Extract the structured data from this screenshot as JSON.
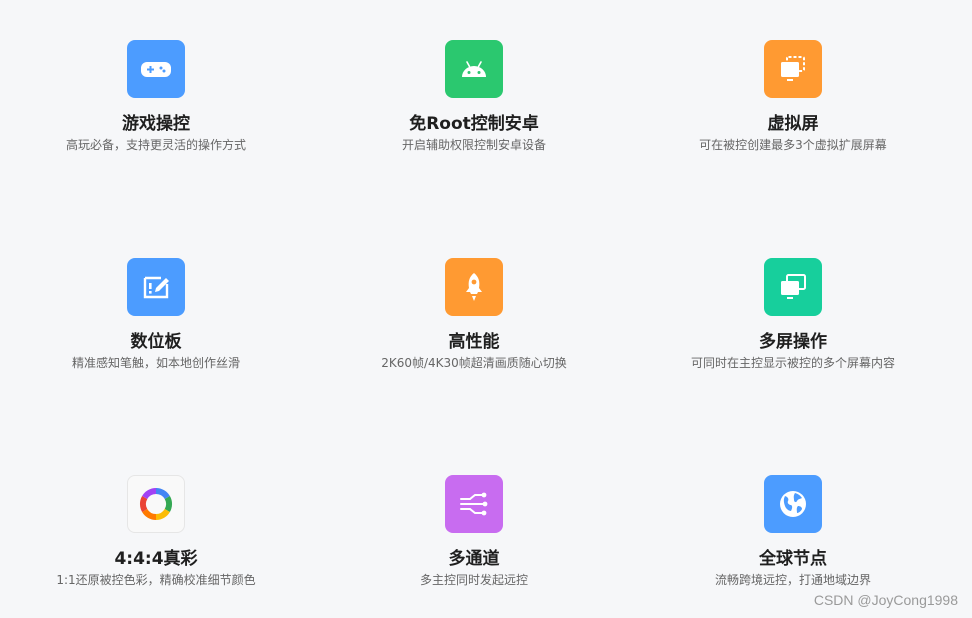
{
  "features": [
    {
      "title": "游戏操控",
      "desc": "高玩必备，支持更灵活的操作方式",
      "icon": "gamepad-icon",
      "color": "#4c9cff"
    },
    {
      "title": "免Root控制安卓",
      "desc": "开启辅助权限控制安卓设备",
      "icon": "android-icon",
      "color": "#2bc86f"
    },
    {
      "title": "虚拟屏",
      "desc": "可在被控创建最多3个虚拟扩展屏幕",
      "icon": "virtual-screen-icon",
      "color": "#ff9a32"
    },
    {
      "title": "数位板",
      "desc": "精准感知笔触，如本地创作丝滑",
      "icon": "tablet-pen-icon",
      "color": "#4c9cff"
    },
    {
      "title": "高性能",
      "desc": "2K60帧/4K30帧超清画质随心切换",
      "icon": "rocket-icon",
      "color": "#ff9a32"
    },
    {
      "title": "多屏操作",
      "desc": "可同时在主控显示被控的多个屏幕内容",
      "icon": "multi-screen-icon",
      "color": "#17cf9c"
    },
    {
      "title": "4:4:4真彩",
      "desc": "1:1还原被控色彩，精确校准细节颜色",
      "icon": "color-wheel-icon",
      "color": "#f9f9f9"
    },
    {
      "title": "多通道",
      "desc": "多主控同时发起远控",
      "icon": "multi-channel-icon",
      "color": "#c86cf0"
    },
    {
      "title": "全球节点",
      "desc": "流畅跨境远控，打通地域边界",
      "icon": "globe-icon",
      "color": "#4c9cff"
    }
  ],
  "watermark": "CSDN @JoyCong1998"
}
